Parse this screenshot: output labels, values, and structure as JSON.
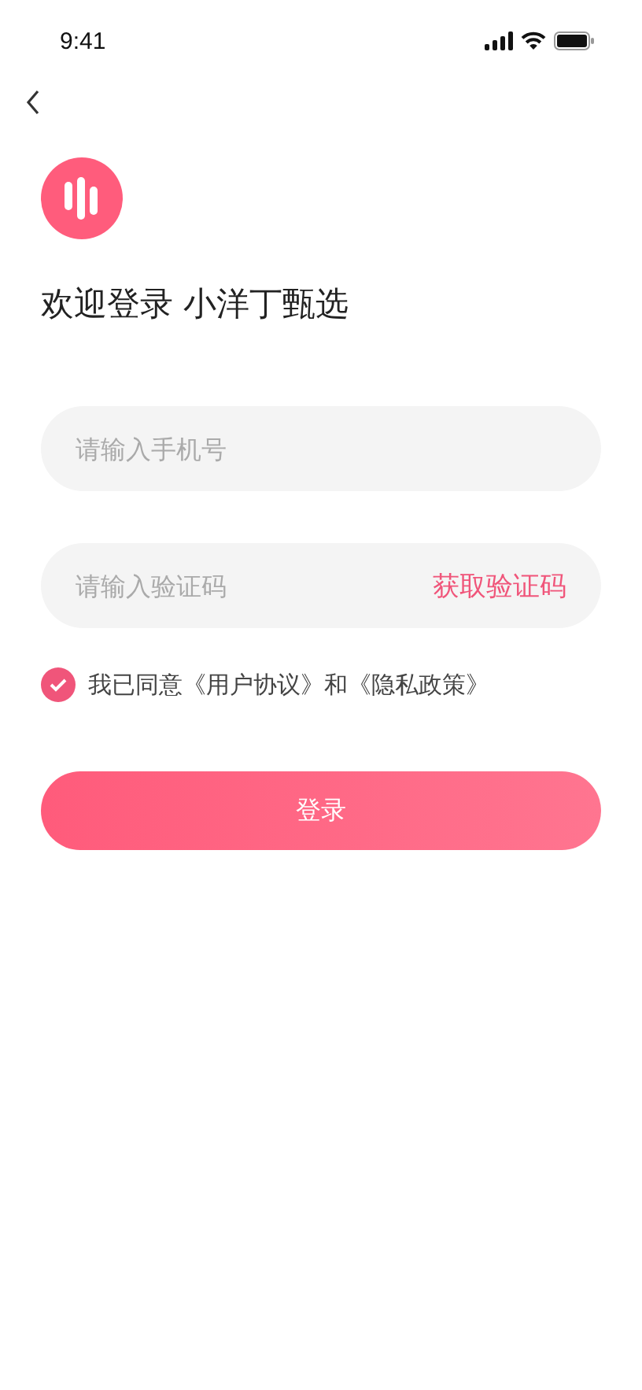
{
  "status_bar": {
    "time": "9:41"
  },
  "title": "欢迎登录 小洋丁甄选",
  "phone_field": {
    "placeholder": "请输入手机号"
  },
  "code_field": {
    "placeholder": "请输入验证码",
    "action": "获取验证码"
  },
  "agreement": {
    "checked": true,
    "text": "我已同意《用户协议》和《隐私政策》"
  },
  "login_button": "登录"
}
